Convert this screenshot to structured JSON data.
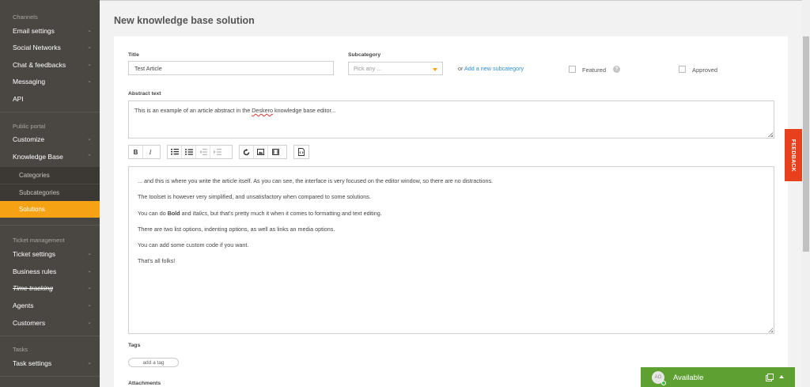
{
  "sidebar": {
    "section_channels": "Channels",
    "channels": [
      {
        "label": "Email settings"
      },
      {
        "label": "Social Networks"
      },
      {
        "label": "Chat & feedbacks"
      },
      {
        "label": "Messaging"
      },
      {
        "label": "API"
      }
    ],
    "section_portal": "Public portal",
    "portal": [
      {
        "label": "Customize"
      },
      {
        "label": "Knowledge Base"
      }
    ],
    "kb_sub": [
      {
        "label": "Categories"
      },
      {
        "label": "Subcategories"
      },
      {
        "label": "Solutions"
      }
    ],
    "section_tickets": "Ticket management",
    "tickets": [
      {
        "label": "Ticket settings"
      },
      {
        "label": "Business rules"
      },
      {
        "label": "Time tracking"
      },
      {
        "label": "Agents"
      },
      {
        "label": "Customers"
      }
    ],
    "section_tasks": "Tasks",
    "tasks": [
      {
        "label": "Task settings"
      }
    ]
  },
  "page": {
    "title": "New knowledge base solution"
  },
  "form": {
    "title_label": "Title",
    "title_value": "Test Article",
    "subcategory_label": "Subcategory",
    "subcategory_placeholder": "Pick any ...",
    "or_text": "or",
    "add_subcategory_link": "Add a new subcategory",
    "featured_label": "Featured",
    "approved_label": "Approved",
    "abstract_label": "Abstract text",
    "abstract_pre": "This is an example of an article abstract in the ",
    "abstract_word": "Deskero",
    "abstract_post": " knowledge base editor...",
    "tags_label": "Tags",
    "add_tag": "add a tag",
    "attachments_label": "Attachments"
  },
  "toolbar": {
    "bold": "B",
    "italic": "I"
  },
  "editor": {
    "p1": "... and this is where you write the article itself. As you can see, the interface is very focused on the editor window, so there are no distractions.",
    "p2": "The toolset is however very simplified, and unsatisfactory when compared to some solutions.",
    "p3_a": "You can do ",
    "p3_bold": "Bold",
    "p3_b": " and ",
    "p3_italic": "Italics",
    "p3_c": ", but that's pretty much it when it comes to formatting and text editing.",
    "p4": "There are two list options, indenting options, as well as links an media options.",
    "p5": "You can add some custom code if you want.",
    "p6": "That's all folks!"
  },
  "feedback_tab": "FEEDBACK",
  "status": {
    "initials": "AO",
    "label": "Available"
  },
  "colors": {
    "sidebar_bg": "#4a4642",
    "accent_orange": "#f5a313",
    "feedback_red": "#e8401c",
    "status_green": "#5ea032",
    "link_blue": "#2f8fd0"
  }
}
